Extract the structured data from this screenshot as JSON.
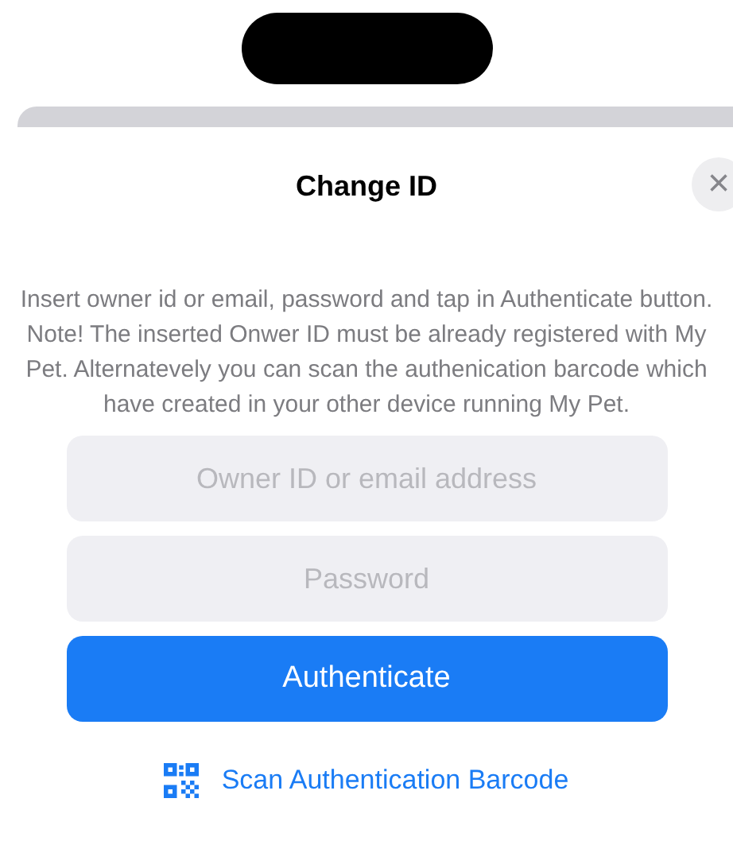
{
  "sheet": {
    "title": "Change ID",
    "close_icon": "×"
  },
  "instructions": "Insert owner id or email, password and tap in Authenticate button. Note! The inserted Onwer ID must be already registered with My Pet. Alternatevely you can scan the authenication barcode which have created in your other device running My Pet.",
  "fields": [
    {
      "placeholder": "Owner ID or email address"
    },
    {
      "placeholder": "Password"
    }
  ],
  "primary_button": "Authenticate",
  "scan_link": "Scan Authentication Barcode"
}
